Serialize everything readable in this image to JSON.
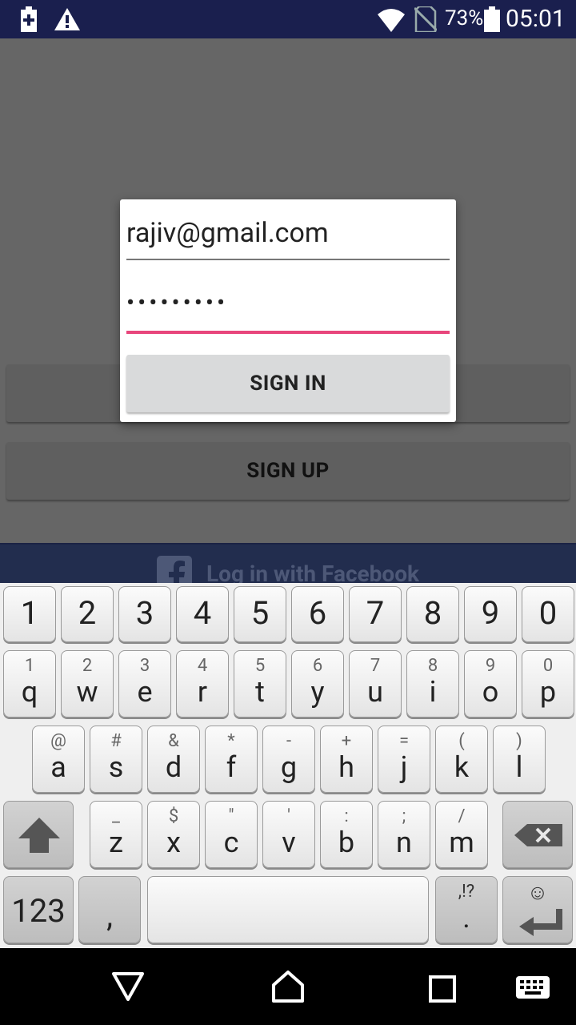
{
  "status_bar": {
    "battery_percent": "73%",
    "time": "05:01",
    "icons": [
      "battery-saver-icon",
      "warning-icon",
      "wifi-icon",
      "no-sim-icon",
      "battery-icon"
    ]
  },
  "background": {
    "sign_up_label": "SIGN UP",
    "facebook_label": "Log in with Facebook"
  },
  "dialog": {
    "email_value": "rajiv@gmail.com",
    "password_mask": "•••••••••",
    "sign_in_label": "SIGN IN",
    "colors": {
      "focus_underline": "#e8467c",
      "field_underline": "#777777"
    }
  },
  "keyboard": {
    "number_row": [
      "1",
      "2",
      "3",
      "4",
      "5",
      "6",
      "7",
      "8",
      "9",
      "0"
    ],
    "row1": [
      {
        "hint": "1",
        "key": "q"
      },
      {
        "hint": "2",
        "key": "w"
      },
      {
        "hint": "3",
        "key": "e"
      },
      {
        "hint": "4",
        "key": "r"
      },
      {
        "hint": "5",
        "key": "t"
      },
      {
        "hint": "6",
        "key": "y"
      },
      {
        "hint": "7",
        "key": "u"
      },
      {
        "hint": "8",
        "key": "i"
      },
      {
        "hint": "9",
        "key": "o"
      },
      {
        "hint": "0",
        "key": "p"
      }
    ],
    "row2": [
      {
        "hint": "@",
        "key": "a"
      },
      {
        "hint": "#",
        "key": "s"
      },
      {
        "hint": "&",
        "key": "d"
      },
      {
        "hint": "*",
        "key": "f"
      },
      {
        "hint": "-",
        "key": "g"
      },
      {
        "hint": "+",
        "key": "h"
      },
      {
        "hint": "=",
        "key": "j"
      },
      {
        "hint": "(",
        "key": "k"
      },
      {
        "hint": ")",
        "key": "l"
      }
    ],
    "row3": [
      {
        "hint": "_",
        "key": "z"
      },
      {
        "hint": "$",
        "key": "x"
      },
      {
        "hint": "\"",
        "key": "c"
      },
      {
        "hint": "'",
        "key": "v"
      },
      {
        "hint": ":",
        "key": "b"
      },
      {
        "hint": ";",
        "key": "n"
      },
      {
        "hint": "/",
        "key": "m"
      }
    ],
    "symbols_label": "123",
    "comma_label": ",",
    "punct_hint": ",!?",
    "period_label": ".",
    "emoji_hint": "☺"
  },
  "nav_bar": {
    "icons": [
      "back-icon",
      "home-icon",
      "recents-icon",
      "keyboard-switch-icon"
    ]
  }
}
